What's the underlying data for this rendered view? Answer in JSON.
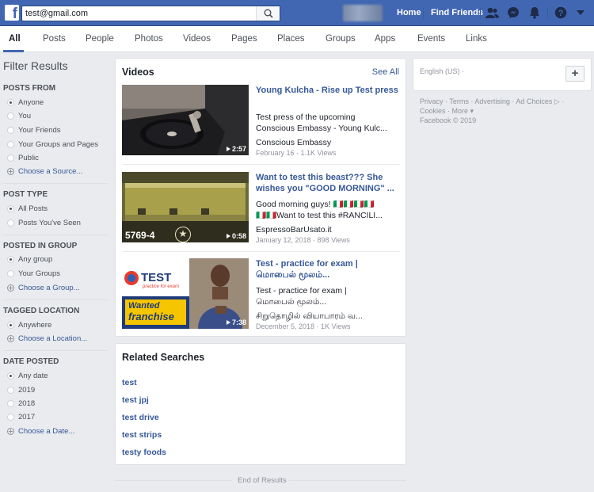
{
  "header": {
    "logo": "f",
    "search_value": "test@gmail.com",
    "nav": [
      "Home",
      "Find Friends"
    ],
    "icons": [
      "friends-icon",
      "messenger-icon",
      "notifications-icon",
      "help-icon",
      "caret-down-icon"
    ]
  },
  "tabs": [
    "All",
    "Posts",
    "People",
    "Photos",
    "Videos",
    "Pages",
    "Places",
    "Groups",
    "Apps",
    "Events",
    "Links"
  ],
  "filters": {
    "title": "Filter Results",
    "sections": [
      {
        "title": "POSTS FROM",
        "options": [
          "Anyone",
          "You",
          "Your Friends",
          "Your Groups and Pages",
          "Public"
        ],
        "selected": 0,
        "link": "Choose a Source..."
      },
      {
        "title": "POST TYPE",
        "options": [
          "All Posts",
          "Posts You've Seen"
        ],
        "selected": 0
      },
      {
        "title": "POSTED IN GROUP",
        "options": [
          "Any group",
          "Your Groups"
        ],
        "selected": 0,
        "link": "Choose a Group..."
      },
      {
        "title": "TAGGED LOCATION",
        "options": [
          "Anywhere"
        ],
        "selected": 0,
        "link": "Choose a Location..."
      },
      {
        "title": "DATE POSTED",
        "options": [
          "Any date",
          "2019",
          "2018",
          "2017"
        ],
        "selected": 0,
        "link": "Choose a Date..."
      }
    ]
  },
  "videos_card": {
    "title": "Videos",
    "see_all": "See All",
    "items": [
      {
        "title": "Young Kulcha - Rise up Test press",
        "desc1": "Test press of the upcoming",
        "desc2": "Conscious Embassy - Young Kulc...",
        "channel": "Conscious Embassy",
        "meta": "February 16 · 1.1K Views",
        "duration": "2:57"
      },
      {
        "title": "Want to test this beast??? She wishes you \"GOOD MORNING\" ...",
        "desc1": "Good morning guys! 🇮🇹🇮🇹🇮🇹🇮🇹",
        "desc2": "🇮🇹🇮🇹Want to test this #RANCILI...",
        "channel": "EspressoBarUsato.it",
        "meta": "January 12, 2018 · 898 Views",
        "duration": "0:58",
        "badge": "5769-4"
      },
      {
        "title": "Test - practice for exam | மொபைல் மூலம்...",
        "desc1": "Test - practice for exam |",
        "desc2": "மொபைல் மூலம்...",
        "channel": "சிறுதொழில் வியாபாரம் வ...",
        "meta": "December 5, 2018 · 1K Views",
        "duration": "7:38",
        "thumb_test": "TEST",
        "thumb_tag": "practice for exam",
        "thumb_wanted": "Wanted",
        "thumb_franchise": "franchise"
      }
    ]
  },
  "related": {
    "title": "Related Searches",
    "items": [
      "test",
      "test jpj",
      "test drive",
      "test strips",
      "testy foods"
    ]
  },
  "end_text": "End of Results",
  "right": {
    "language": "English (US) ·",
    "plus": "+",
    "footer_line1": "Privacy · Terms · Advertising · Ad Choices ▷ ·",
    "footer_line2": "Cookies · More ▾",
    "footer_line3": "Facebook © 2019"
  }
}
